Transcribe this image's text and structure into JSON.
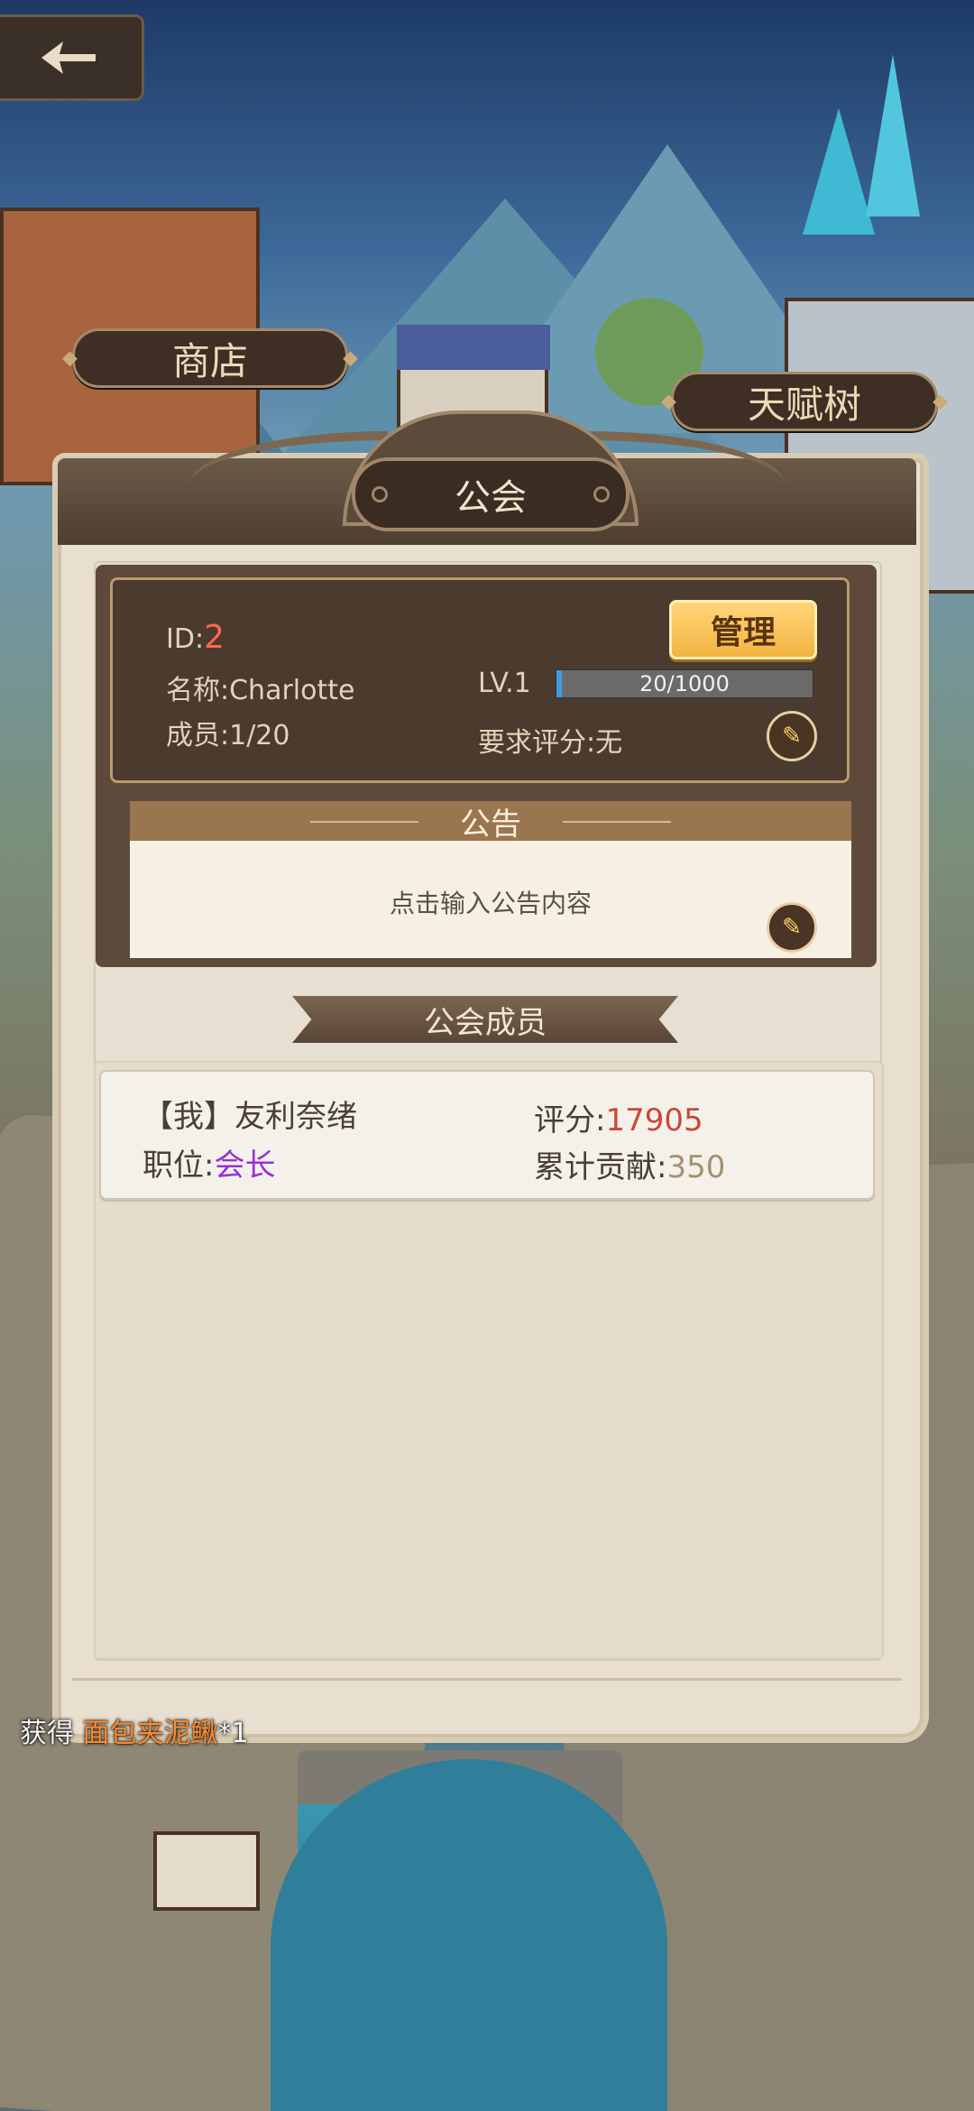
{
  "map": {
    "shop_label": "商店",
    "talent_label": "天赋树"
  },
  "guild_panel": {
    "title": "公会",
    "manage_label": "管理",
    "id_prefix": "ID:",
    "id_value": "2",
    "name_text": "名称:Charlotte",
    "members_text": "成员:1/20",
    "level_text": "LV.1",
    "exp_text": "20/1000",
    "exp_fraction": 0.02,
    "requirement_text": "要求评分:无"
  },
  "notice": {
    "title": "公告",
    "placeholder": "点击输入公告内容"
  },
  "members": {
    "title": "公会成员",
    "list": [
      {
        "name": "【我】友利奈绪",
        "position_label": "职位:",
        "position_value": "会长",
        "score_label": "评分:",
        "score_value": "17905",
        "contribution_label": "累计贡献:",
        "contribution_value": "350"
      }
    ]
  },
  "toast": {
    "prefix": "获得",
    "item": "面包夹泥鳅",
    "suffix": "*1"
  },
  "colors": {
    "accent_gold": "#f2b440",
    "rank_purple": "#9a30d8",
    "score_red": "#c9473a",
    "id_red": "#ff6a4a",
    "item_orange": "#ff8a2a"
  },
  "icons": {
    "back": "back-arrow-icon",
    "edit": "pencil-icon"
  }
}
